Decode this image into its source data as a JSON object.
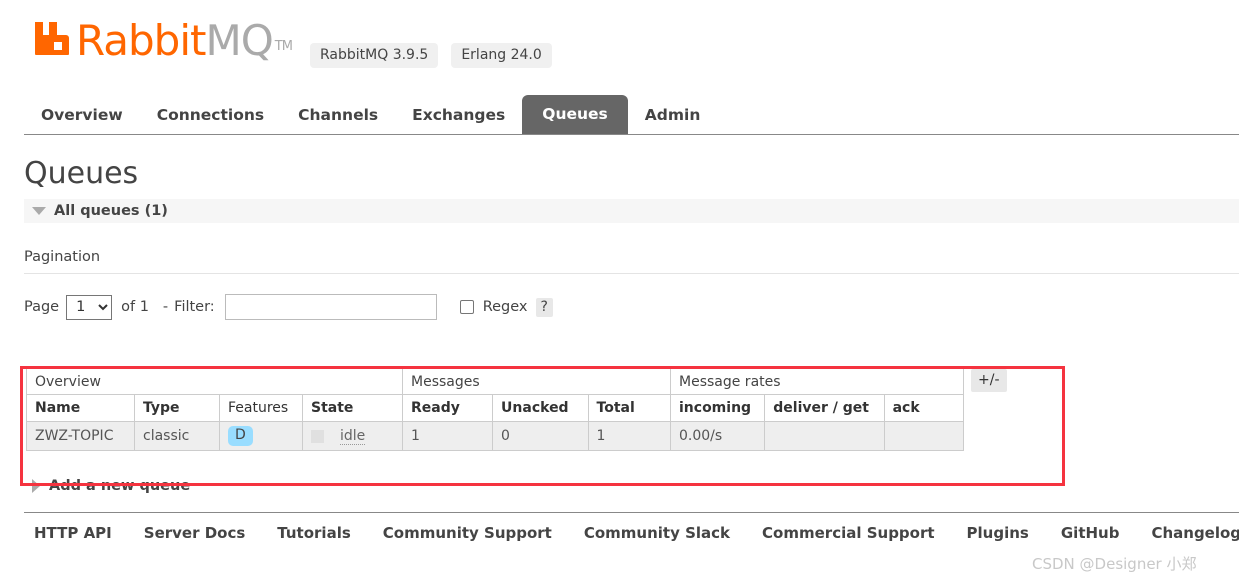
{
  "header": {
    "logo_name_part1": "Rabbit",
    "logo_name_part2": "MQ",
    "trademark": "TM",
    "badges": [
      {
        "label": "RabbitMQ 3.9.5"
      },
      {
        "label": "Erlang 24.0"
      }
    ]
  },
  "nav": {
    "tabs": [
      {
        "label": "Overview",
        "active": false
      },
      {
        "label": "Connections",
        "active": false
      },
      {
        "label": "Channels",
        "active": false
      },
      {
        "label": "Exchanges",
        "active": false
      },
      {
        "label": "Queues",
        "active": true
      },
      {
        "label": "Admin",
        "active": false
      }
    ]
  },
  "page": {
    "title": "Queues",
    "section_label": "All queues (1)"
  },
  "pagination": {
    "title": "Pagination",
    "page_label": "Page",
    "page_value": "1",
    "page_options": [
      "1"
    ],
    "of_label": "of 1",
    "dash": "-",
    "filter_label": "Filter:",
    "filter_value": "",
    "filter_placeholder": "",
    "regex_label": "Regex",
    "help_label": "?"
  },
  "table": {
    "group_headers": [
      {
        "label": "Overview",
        "span": 4
      },
      {
        "label": "Messages",
        "span": 3
      },
      {
        "label": "Message rates",
        "span": 3
      }
    ],
    "columns": [
      {
        "label": "Name",
        "sortable": true,
        "align": "left"
      },
      {
        "label": "Type",
        "sortable": true,
        "align": "left"
      },
      {
        "label": "Features",
        "sortable": false,
        "align": "left"
      },
      {
        "label": "State",
        "sortable": true,
        "align": "left"
      },
      {
        "label": "Ready",
        "sortable": true,
        "align": "left"
      },
      {
        "label": "Unacked",
        "sortable": true,
        "align": "left"
      },
      {
        "label": "Total",
        "sortable": true,
        "align": "left"
      },
      {
        "label": "incoming",
        "sortable": true,
        "align": "left"
      },
      {
        "label": "deliver / get",
        "sortable": true,
        "align": "left"
      },
      {
        "label": "ack",
        "sortable": true,
        "align": "left"
      }
    ],
    "rows": [
      {
        "name": "ZWZ-TOPIC",
        "type": "classic",
        "features": "D",
        "state": "idle",
        "ready": "1",
        "unacked": "0",
        "total": "1",
        "incoming": "0.00/s",
        "deliver_get": "",
        "ack": ""
      }
    ],
    "toggle_columns_label": "+/-"
  },
  "add_queue": {
    "label": "Add a new queue"
  },
  "footer": {
    "links": [
      {
        "label": "HTTP API"
      },
      {
        "label": "Server Docs"
      },
      {
        "label": "Tutorials"
      },
      {
        "label": "Community Support"
      },
      {
        "label": "Community Slack"
      },
      {
        "label": "Commercial Support"
      },
      {
        "label": "Plugins"
      },
      {
        "label": "GitHub"
      },
      {
        "label": "Changelog"
      }
    ]
  },
  "watermark": {
    "text": "CSDN @Designer 小郑"
  },
  "colors": {
    "brand_orange": "#f60",
    "logo_gray": "#aaaaaa",
    "active_tab_bg": "#666666",
    "annotation_red": "#f5333f",
    "feature_badge_bg": "#99ddff",
    "row_bg": "#eeeeee"
  }
}
